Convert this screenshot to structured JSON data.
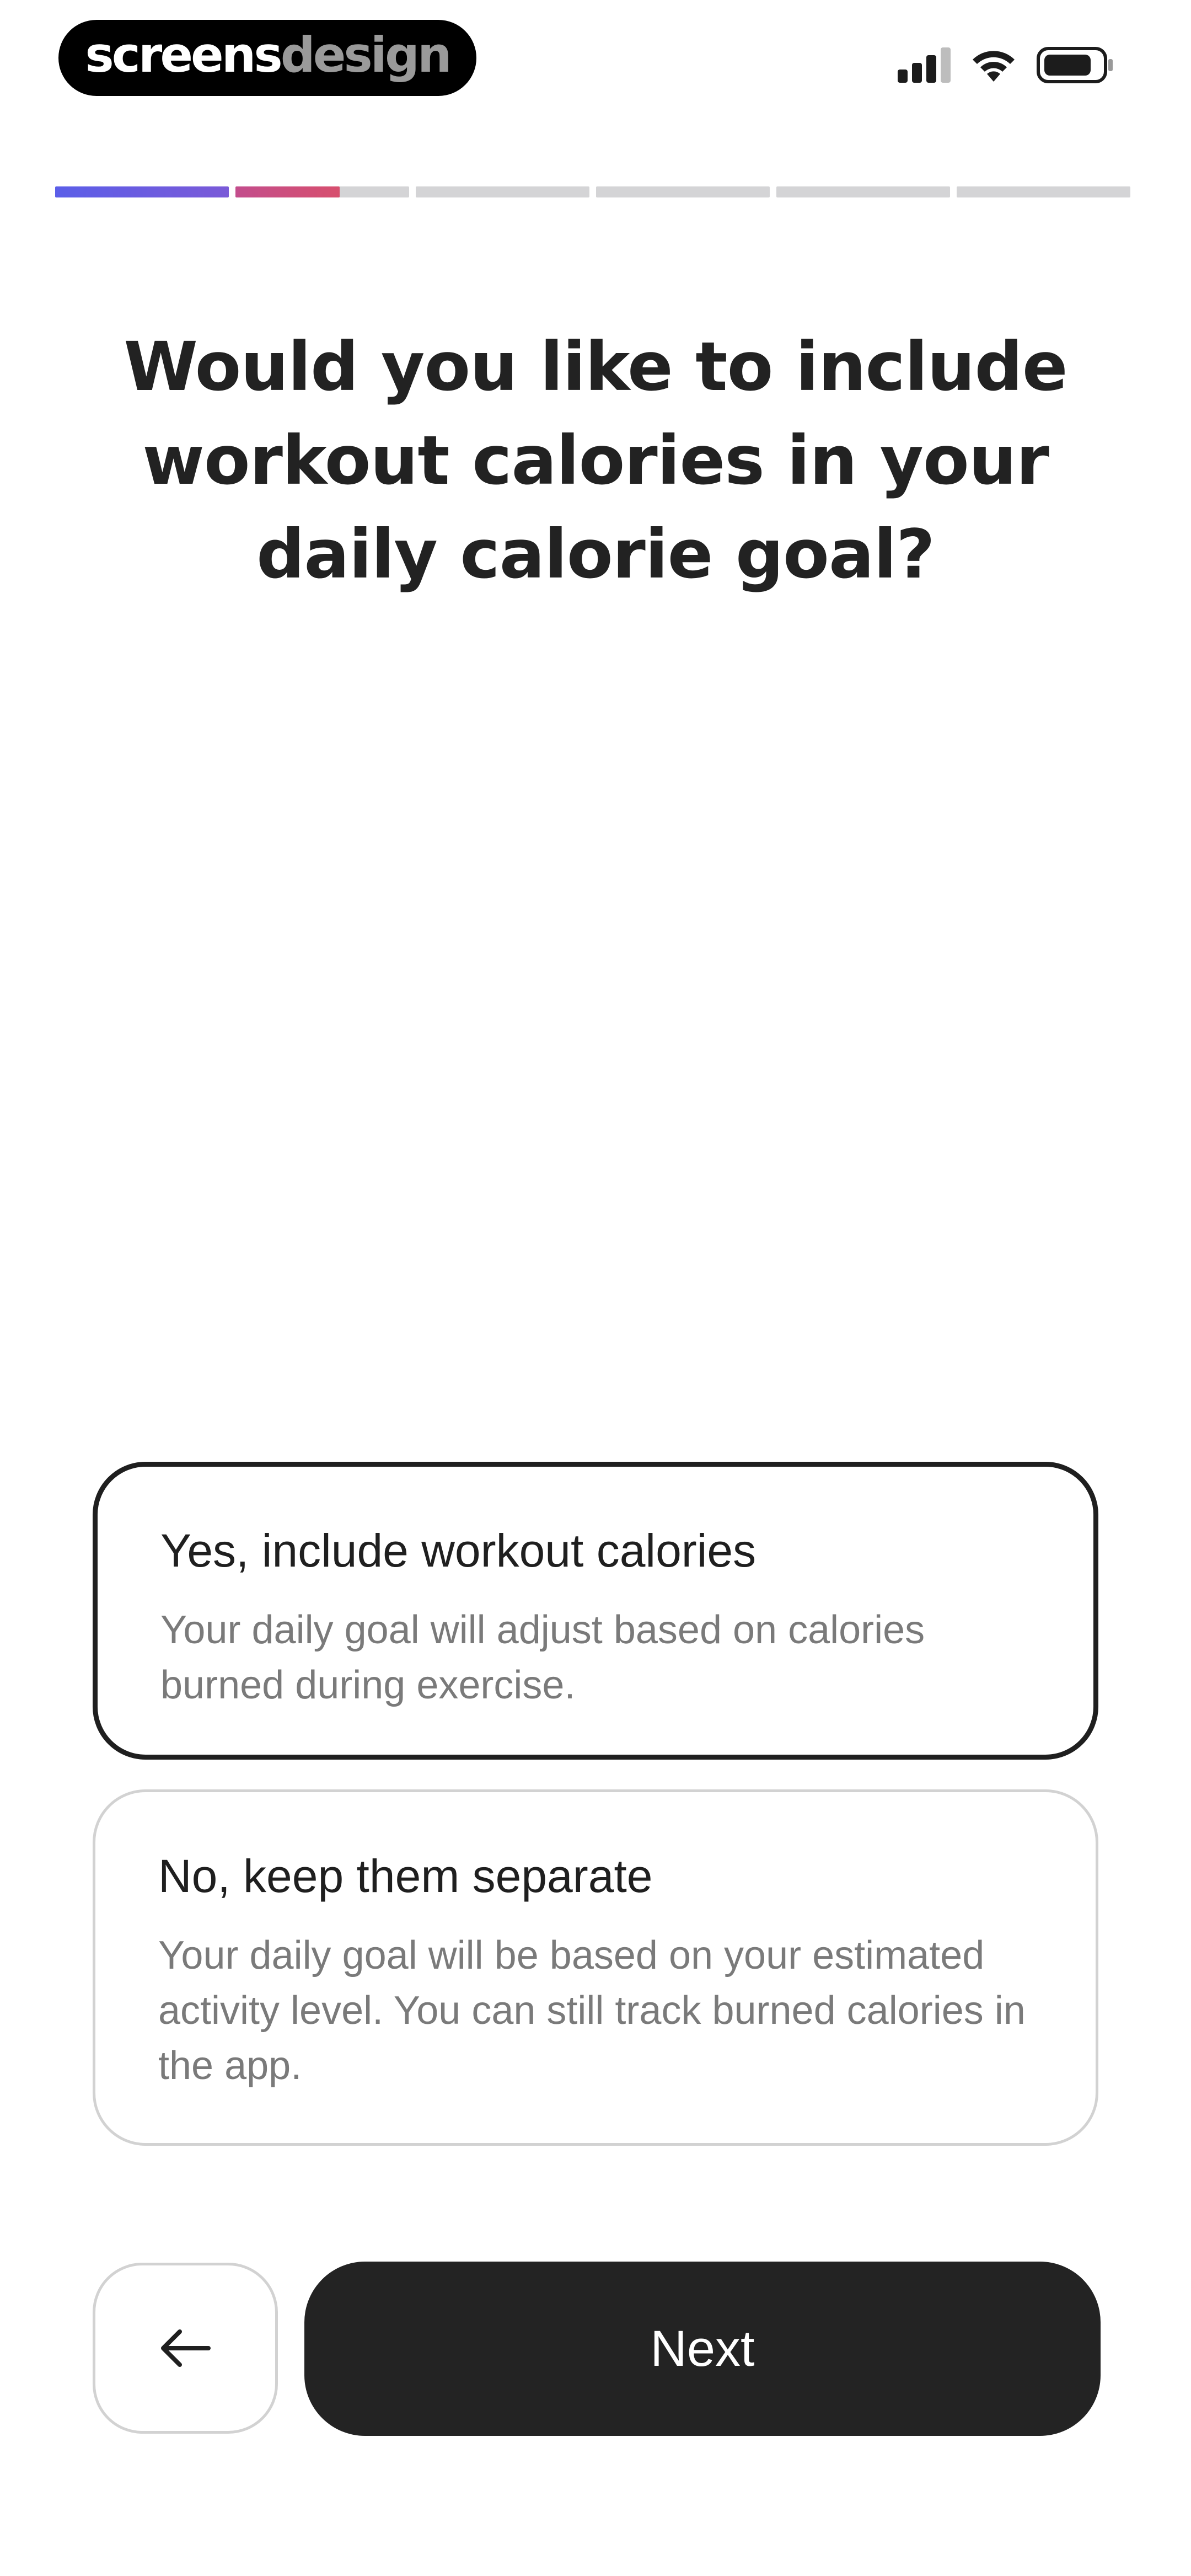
{
  "status_bar": {
    "brand_part_1": "screens",
    "brand_part_2": "design",
    "icons": [
      "signal-icon",
      "wifi-icon",
      "battery-icon"
    ]
  },
  "progress": {
    "segments": [
      {
        "fill": 1.0,
        "color": "#7a5ad8"
      },
      {
        "fill": 0.6,
        "color": "#c34d8c"
      },
      {
        "fill": 0
      },
      {
        "fill": 0
      },
      {
        "fill": 0
      },
      {
        "fill": 0
      }
    ],
    "track_color": "#d4d4d6"
  },
  "question": {
    "title": "Would you like to include workout calories in your daily calorie goal?"
  },
  "options": [
    {
      "title": "Yes, include workout calories",
      "description": "Your daily goal will adjust based on calories burned during exercise.",
      "selected": true
    },
    {
      "title": "No, keep them separate",
      "description": "Your daily goal will be based on your estimated activity level. You can still track burned calories in the app.",
      "selected": false
    }
  ],
  "footer": {
    "back_icon": "arrow-left-icon",
    "next_label": "Next"
  },
  "colors": {
    "primary": "#232323",
    "selected_border": "#1f1f1f",
    "unselected_border": "#d2d2d2",
    "muted_text": "#7a7a7a",
    "progress_gradient_start": "#5b5ee8",
    "progress_gradient_end": "#d74f6e"
  }
}
